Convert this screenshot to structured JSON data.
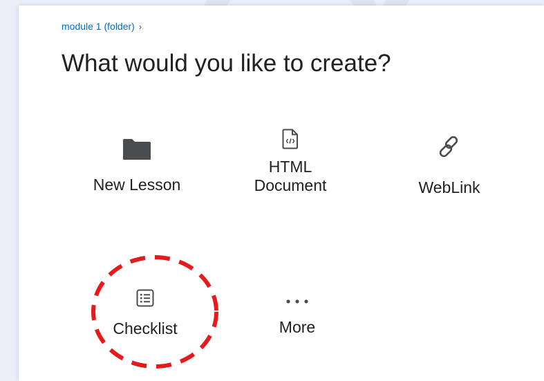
{
  "breadcrumb": {
    "link_label": "module 1 (folder)",
    "separator": "›"
  },
  "page": {
    "title": "What would you like to create?"
  },
  "options": {
    "new_lesson": {
      "label": "New Lesson",
      "icon": "folder-icon"
    },
    "html_document": {
      "label_line1": "HTML",
      "label_line2": "Document",
      "icon": "html-file-icon"
    },
    "weblink": {
      "label": "WebLink",
      "icon": "link-icon"
    },
    "checklist": {
      "label": "Checklist",
      "icon": "checklist-icon"
    },
    "more": {
      "label": "More",
      "icon": "more-icon"
    }
  },
  "colors": {
    "link": "#006fbf",
    "text": "#202122",
    "icon": "#494c4e",
    "highlight": "#e8191b",
    "backdrop": "#ebeef8"
  }
}
